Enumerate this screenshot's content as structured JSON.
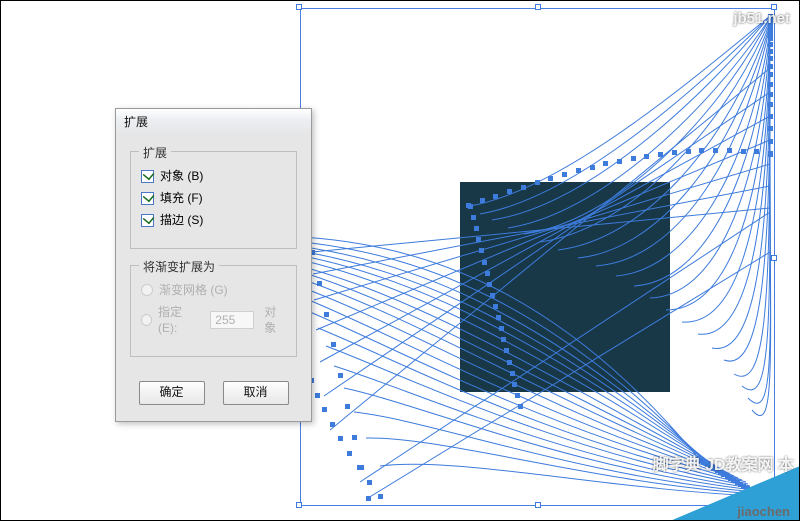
{
  "dialog": {
    "title": "扩展",
    "group_expand": {
      "title": "扩展",
      "object_label": "对象 (B)",
      "object_checked": true,
      "fill_label": "填充 (F)",
      "fill_checked": true,
      "stroke_label": "描边 (S)",
      "stroke_checked": true
    },
    "group_gradient": {
      "title": "将渐变扩展为",
      "radio_mesh_label": "渐变网格 (G)",
      "radio_specify_label": "指定 (E):",
      "specify_value": "255",
      "specify_suffix": "对象"
    },
    "ok_label": "确定",
    "cancel_label": "取消"
  },
  "colors": {
    "selection_blue": "#3d7bdc",
    "dark_fill": "#183847",
    "panel_bg": "#e6e6e6"
  },
  "watermarks": {
    "top_right": "jb51.net",
    "bottom_band": "脚字典 JD教案网 本",
    "bottom_right": "jiaochen"
  }
}
